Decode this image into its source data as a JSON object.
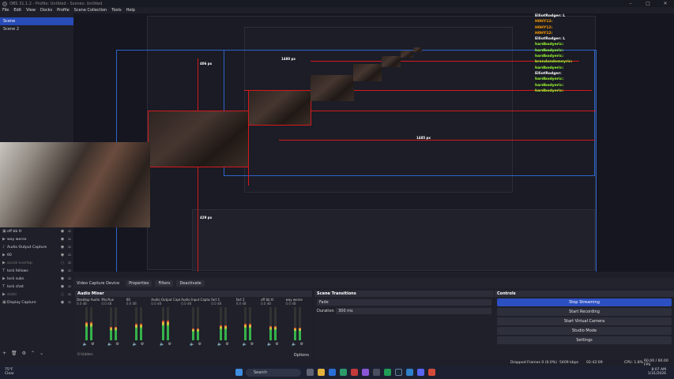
{
  "window": {
    "title": "OBS 31.1.2 - Profile: Untitled - Scenes: Untitled",
    "controls": [
      "–",
      "□",
      "✕"
    ]
  },
  "menu": [
    "File",
    "Edit",
    "View",
    "Docks",
    "Profile",
    "Scene Collection",
    "Tools",
    "Help"
  ],
  "scenes": [
    {
      "label": "Scene",
      "active": true
    },
    {
      "label": "Scene 2",
      "active": false
    }
  ],
  "preview": {
    "labels": {
      "top": "406 px",
      "mid": "429 px",
      "right": "1485 px",
      "small": "1480 px"
    },
    "chat": [
      {
        "name": "ElliotRodger: L",
        "color": "#ffffff"
      },
      {
        "name": "H0HY12:",
        "color": "#ff9d00"
      },
      {
        "name": "H0HY12:",
        "color": "#ff9d00"
      },
      {
        "name": "H0HY12:",
        "color": "#ff9d00"
      },
      {
        "name": "ElliotRodger: L",
        "color": "#ffffff"
      },
      {
        "name": "hardbodyeric:",
        "color": "#9cff2f"
      },
      {
        "name": "hardbodyeric:",
        "color": "#9cff2f"
      },
      {
        "name": "hardbodyeric:",
        "color": "#9cff2f"
      },
      {
        "name": "brandondomeyric:",
        "color": "#9cff2f"
      },
      {
        "name": "hardbodyeric:",
        "color": "#9cff2f"
      },
      {
        "name": "ElliotRodger:",
        "color": "#ffffff"
      },
      {
        "name": "hardbodyeric:",
        "color": "#9cff2f"
      },
      {
        "name": "hardbodyeric:",
        "color": "#9cff2f"
      },
      {
        "name": "hardbodyeric:",
        "color": "#9cff2f"
      }
    ]
  },
  "sources": [
    {
      "icon": "▣",
      "label": "off bb tt",
      "visible": true
    },
    {
      "icon": "▶",
      "label": "way worse",
      "visible": true
    },
    {
      "icon": "♪",
      "label": "Audio Output Capture",
      "visible": true
    },
    {
      "icon": "▶",
      "label": "60",
      "visible": true
    },
    {
      "icon": "▶",
      "label": "social overlap",
      "visible": false
    },
    {
      "icon": "T",
      "label": "lock follows",
      "visible": true
    },
    {
      "icon": "▶",
      "label": "lock subs",
      "visible": true
    },
    {
      "icon": "T",
      "label": "lock chat",
      "visible": true
    },
    {
      "icon": "▶",
      "label": "static",
      "visible": false
    },
    {
      "icon": "▣",
      "label": "Display Capture",
      "visible": true
    }
  ],
  "selection": {
    "source": "Video Capture Device",
    "properties": "Properties",
    "filters": "Filters",
    "deactivate": "Deactivate"
  },
  "mixer": {
    "title": "Audio Mixer",
    "channels": [
      {
        "name": "Desktop Audio",
        "db": "0.0 dB",
        "level": 0.55
      },
      {
        "name": "Mic/Aux",
        "db": "0.0 dB",
        "level": 0.4
      },
      {
        "name": "60",
        "db": "0.0 dB",
        "level": 0.5
      },
      {
        "name": "Audio Output Capture",
        "db": "0.0 dB",
        "level": 0.6
      },
      {
        "name": "Audio Input Capture",
        "db": "0.0 dB",
        "level": 0.35
      },
      {
        "name": "fart 1",
        "db": "0.0 dB",
        "level": 0.45
      },
      {
        "name": "fart 2",
        "db": "0.0 dB",
        "level": 0.5
      },
      {
        "name": "off bb tt",
        "db": "0.0 dB",
        "level": 0.42
      },
      {
        "name": "way worse",
        "db": "0.0 dB",
        "level": 0.38
      }
    ],
    "footer": "0 hidden",
    "options_label": "Options"
  },
  "transitions": {
    "title": "Scene Transitions",
    "selected": "Fade",
    "duration_label": "Duration",
    "duration_value": "300 ms"
  },
  "controls": {
    "title": "Controls",
    "stop_streaming": "Stop Streaming",
    "start_recording": "Start Recording",
    "start_virtual_camera": "Start Virtual Camera",
    "studio_mode": "Studio Mode",
    "settings": "Settings"
  },
  "status": {
    "dropped": "Dropped Frames 0 (0.0%)",
    "kbps": "5409 kbps",
    "time": "02:42:09",
    "cpu": "CPU: 1.8%",
    "fps": "60.00 / 60.00 FPS"
  },
  "taskbar": {
    "weather_temp": "75°F",
    "weather_cond": "Clear",
    "search": "Search",
    "time": "8:07 AM",
    "date": "1/31/2026"
  }
}
